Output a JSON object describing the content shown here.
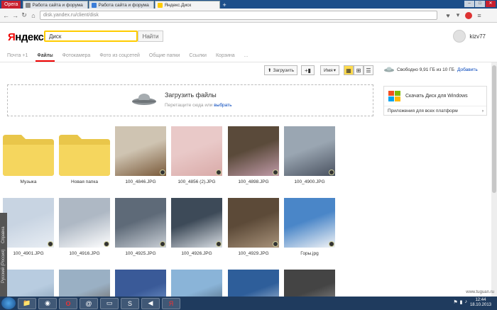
{
  "browser": {
    "menu_label": "Opera",
    "tabs": [
      {
        "title": "Работа сайта и форума",
        "fav_color": "#888888"
      },
      {
        "title": "Работа сайта и форума",
        "fav_color": "#3b7dd8"
      },
      {
        "title": "Яндекс.Диск",
        "fav_color": "#ffcc00"
      }
    ],
    "new_tab": "+",
    "url": "disk.yandex.ru/client/disk"
  },
  "header": {
    "logo_first": "Я",
    "logo_rest": "ндекс",
    "search_value": "Диск",
    "find_label": "Найти",
    "username": "kizv77"
  },
  "services": [
    {
      "label": "Почта +1",
      "active": false
    },
    {
      "label": "Файлы",
      "active": true
    },
    {
      "label": "Фотокамера",
      "active": false
    },
    {
      "label": "Фото из соцсетей",
      "active": false
    },
    {
      "label": "Общие папки",
      "active": false
    },
    {
      "label": "Ссылки",
      "active": false
    },
    {
      "label": "Корзина",
      "active": false
    },
    {
      "label": "...",
      "active": false
    }
  ],
  "toolbar": {
    "upload_label": "Загрузить",
    "sort_label": "Имя",
    "space_label": "Свободно 9,91 ГБ из 10 ГБ",
    "add_label": "Добавить"
  },
  "dropzone": {
    "title": "Загрузить файлы",
    "sub_prefix": "Перетащите сюда или",
    "sub_link": "выбрать"
  },
  "promo": {
    "download_label": "Скачать Диск для Windows",
    "platforms_label": "Приложения для всех платформ"
  },
  "files": [
    {
      "name": "Музыка",
      "kind": "folder"
    },
    {
      "name": "Новая папка",
      "kind": "folder"
    },
    {
      "name": "100_4846.JPG",
      "kind": "photo",
      "colors": [
        "#cfc4b2",
        "#7a5a3a"
      ]
    },
    {
      "name": "100_4856 (2).JPG",
      "kind": "photo",
      "colors": [
        "#e9c9c8",
        "#d9aaa8"
      ]
    },
    {
      "name": "100_4898.JPG",
      "kind": "photo",
      "colors": [
        "#5a4a3a",
        "#c09aa8"
      ]
    },
    {
      "name": "100_4900.JPG",
      "kind": "photo",
      "colors": [
        "#9aa6b2",
        "#4a5260"
      ]
    },
    {
      "name": "100_4901.JPG",
      "kind": "photo",
      "colors": [
        "#c8d4e2",
        "#e9eef4"
      ]
    },
    {
      "name": "100_4916.JPG",
      "kind": "photo",
      "colors": [
        "#aeb8c4",
        "#ffffff"
      ]
    },
    {
      "name": "100_4925.JPG",
      "kind": "photo",
      "colors": [
        "#5e6a78",
        "#c9cfd6"
      ]
    },
    {
      "name": "100_4926.JPG",
      "kind": "photo",
      "colors": [
        "#3d4a58",
        "#d9dee4"
      ]
    },
    {
      "name": "100_4929.JPG",
      "kind": "photo",
      "colors": [
        "#5c4a38",
        "#a8927a"
      ]
    },
    {
      "name": "Горы.jpg",
      "kind": "photo",
      "colors": [
        "#4a86c8",
        "#f2f4f6"
      ]
    },
    {
      "name": "",
      "kind": "photo",
      "colors": [
        "#b8cce0",
        "#6e8aa4"
      ]
    },
    {
      "name": "",
      "kind": "photo",
      "colors": [
        "#9ab0c4",
        "#5c4a3a"
      ]
    },
    {
      "name": "",
      "kind": "photo",
      "colors": [
        "#3a5a98",
        "#8ab0e0"
      ]
    },
    {
      "name": "",
      "kind": "photo",
      "colors": [
        "#8ab4d8",
        "#3a4a5a"
      ]
    },
    {
      "name": "",
      "kind": "photo",
      "colors": [
        "#2e5e9a",
        "#d8e4ee"
      ]
    },
    {
      "name": "",
      "kind": "photo",
      "colors": [
        "#444444",
        "#aaaaaa"
      ]
    }
  ],
  "sidestrip": {
    "label_a": "Русский (Россия)",
    "label_b": "Справка"
  },
  "taskbar": {
    "apps": [
      "📁",
      "◉",
      "O",
      "@",
      "▭",
      "S",
      "◀",
      "Я"
    ],
    "clock_time": "12:44",
    "clock_date": "18.10.2013"
  },
  "watermark": "www.tuguan.ru",
  "colors": {
    "accent": "#ffcc00",
    "active_tab": "#e00000",
    "link": "#0044bb"
  }
}
